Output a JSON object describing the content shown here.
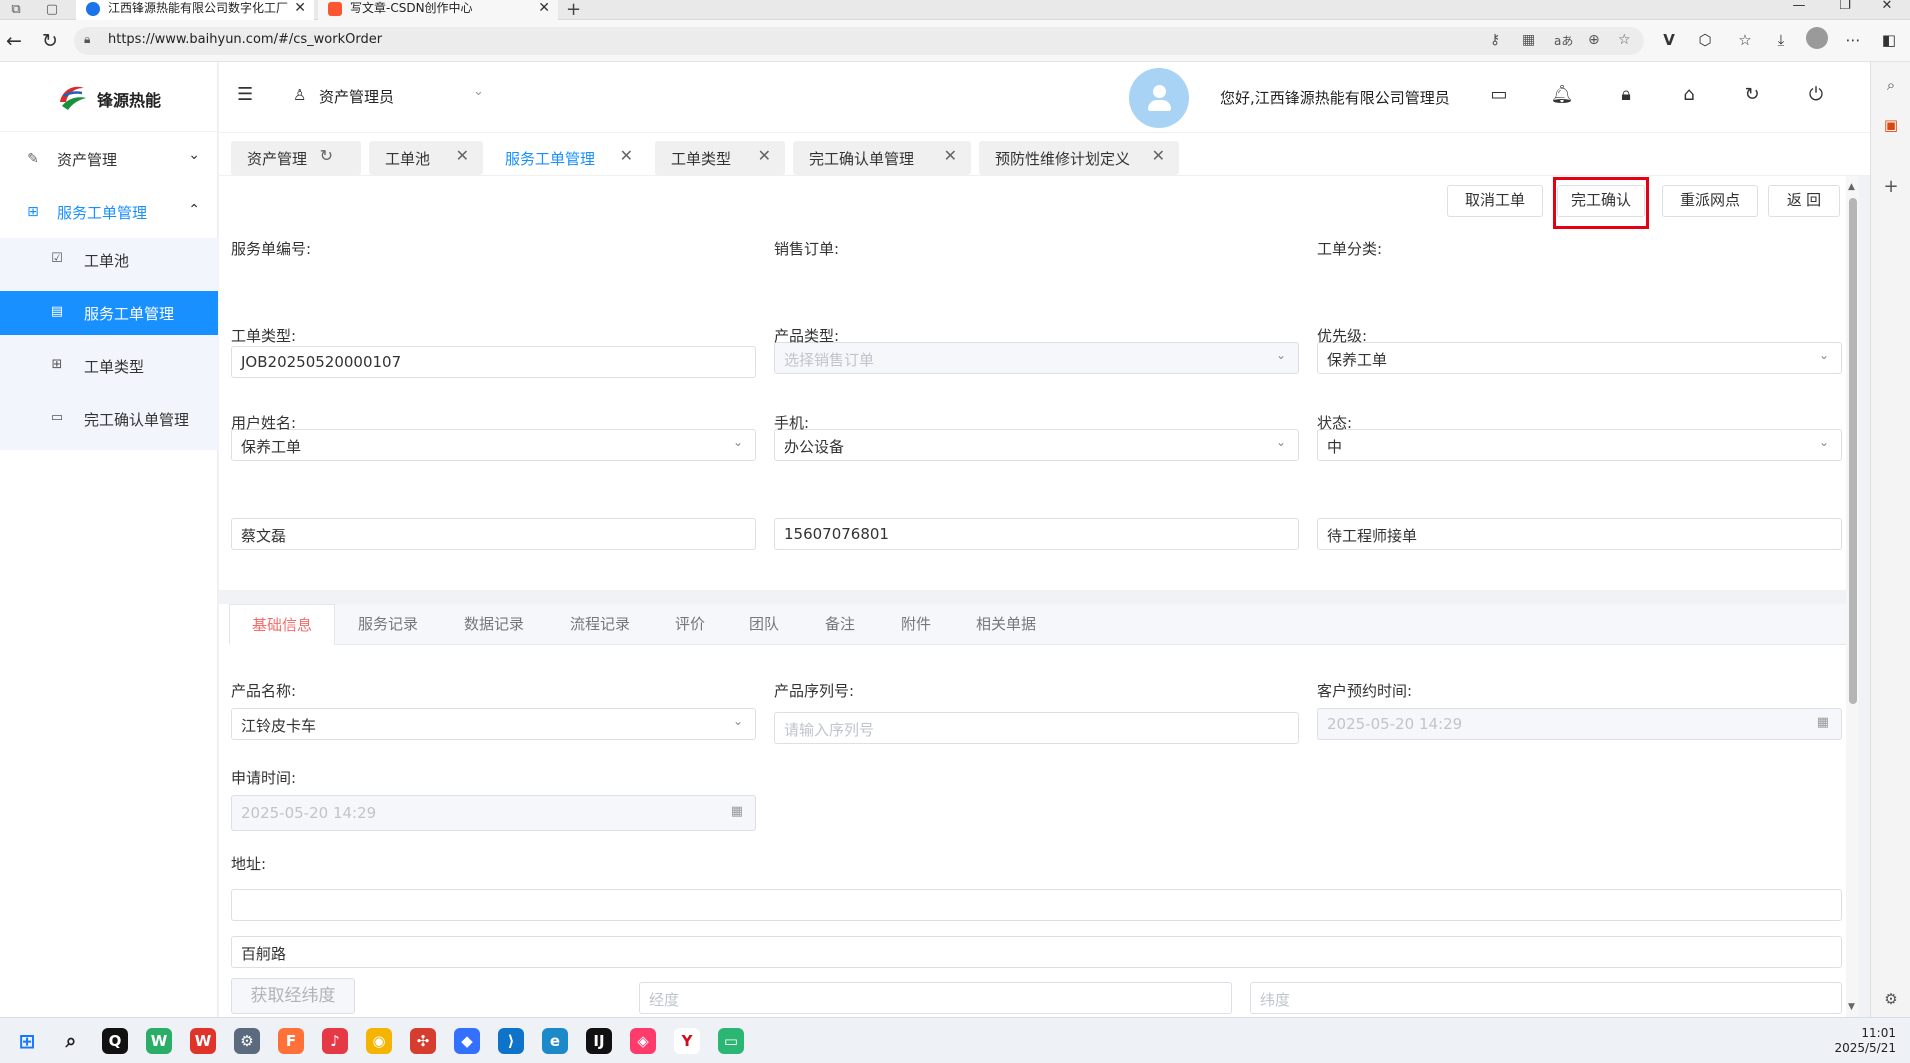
{
  "browser": {
    "tabs": [
      {
        "title": "江西锋源热能有限公司数字化工厂",
        "active": true
      },
      {
        "title": "写文章-CSDN创作中心",
        "active": false
      }
    ],
    "url": "https://www.baihyun.com/#/cs_workOrder"
  },
  "sidebar": {
    "brand": "锋源热能",
    "menu": [
      {
        "label": "资产管理",
        "icon": "asset-icon",
        "expanded": false
      },
      {
        "label": "服务工单管理",
        "icon": "grid-icon",
        "expanded": true
      }
    ],
    "submenu": [
      {
        "label": "工单池",
        "icon": "pool-icon",
        "active": false
      },
      {
        "label": "服务工单管理",
        "icon": "doc-icon",
        "active": true
      },
      {
        "label": "工单类型",
        "icon": "grid-icon",
        "active": false
      },
      {
        "label": "完工确认单管理",
        "icon": "card-icon",
        "active": false
      }
    ]
  },
  "header": {
    "role": "资产管理员",
    "greeting": "您好,江西锋源热能有限公司管理员",
    "icons": [
      "message-icon",
      "bell-icon",
      "lock-icon",
      "home-icon",
      "refresh-icon",
      "power-icon"
    ]
  },
  "tags": [
    {
      "label": "资产管理",
      "closable": false,
      "active": false
    },
    {
      "label": "工单池",
      "closable": true,
      "active": false
    },
    {
      "label": "服务工单管理",
      "closable": true,
      "active": true
    },
    {
      "label": "工单类型",
      "closable": true,
      "active": false
    },
    {
      "label": "完工确认单管理",
      "closable": true,
      "active": false
    },
    {
      "label": "预防性维修计划定义",
      "closable": true,
      "active": false
    }
  ],
  "actions": {
    "cancel": "取消工单",
    "confirm": "完工确认",
    "reassign": "重派网点",
    "back": "返 回"
  },
  "form": {
    "service_no": {
      "label": "服务单编号:",
      "value": "JOB20250520000107"
    },
    "sales_order": {
      "label": "销售订单:",
      "placeholder": "选择销售订单"
    },
    "category": {
      "label": "工单分类:",
      "value": "保养工单"
    },
    "order_type": {
      "label": "工单类型:",
      "value": "保养工单"
    },
    "product_type": {
      "label": "产品类型:",
      "value": "办公设备"
    },
    "priority": {
      "label": "优先级:",
      "value": "中"
    },
    "user_name": {
      "label": "用户姓名:",
      "value": "蔡文磊"
    },
    "phone": {
      "label": "手机:",
      "value": "15607076801"
    },
    "status": {
      "label": "状态:",
      "value": "待工程师接单"
    }
  },
  "detail_tabs": [
    "基础信息",
    "服务记录",
    "数据记录",
    "流程记录",
    "评价",
    "团队",
    "备注",
    "附件",
    "相关单据"
  ],
  "basic": {
    "product_name": {
      "label": "产品名称:",
      "value": "江铃皮卡车"
    },
    "serial_no": {
      "label": "产品序列号:",
      "placeholder": "请输入序列号"
    },
    "appointment": {
      "label": "客户预约时间:",
      "value": "2025-05-20 14:29"
    },
    "apply_time": {
      "label": "申请时间:",
      "value": "2025-05-20 14:29"
    },
    "address": {
      "label": "地址:",
      "line1": "",
      "line2": "百舸路"
    },
    "geo_button": "获取经纬度",
    "longitude_placeholder": "经度",
    "latitude_placeholder": "纬度"
  },
  "taskbar": {
    "time": "11:01",
    "date": "2025/5/21"
  },
  "colors": {
    "primary": "#1890ff",
    "active_tab_text": "#f56c6c",
    "highlight": "#e60012"
  }
}
